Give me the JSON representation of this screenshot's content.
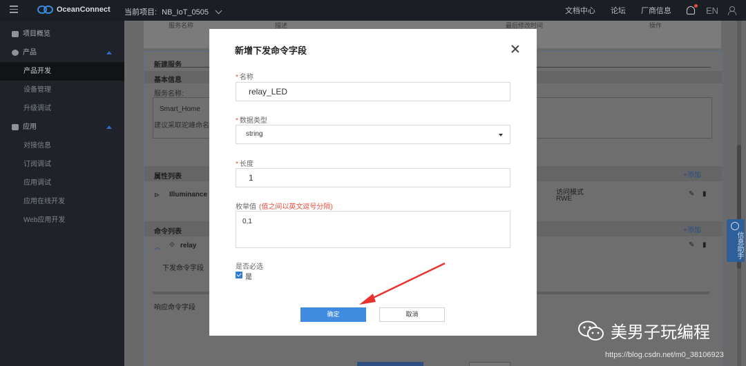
{
  "topbar": {
    "brand": "OceanConnect",
    "project_label": "当前项目:",
    "project_name": "NB_IoT_0505",
    "links": [
      "文档中心",
      "论坛",
      "厂商信息"
    ],
    "lang": "EN"
  },
  "sidebar": {
    "items": [
      {
        "label": "项目概览",
        "type": "top",
        "icon": "dashboard-icon"
      },
      {
        "label": "产品",
        "type": "group",
        "icon": "cube-icon"
      },
      {
        "label": "产品开发",
        "type": "sub",
        "active": true
      },
      {
        "label": "设备管理",
        "type": "sub"
      },
      {
        "label": "升级调试",
        "type": "sub"
      },
      {
        "label": "应用",
        "type": "group",
        "icon": "grid-icon"
      },
      {
        "label": "对接信息",
        "type": "sub"
      },
      {
        "label": "订阅调试",
        "type": "sub"
      },
      {
        "label": "应用调试",
        "type": "sub"
      },
      {
        "label": "应用在线开发",
        "type": "sub"
      },
      {
        "label": "Web应用开发",
        "type": "sub"
      }
    ]
  },
  "background": {
    "header_cols": [
      "服务名称",
      "描述",
      "最后修改时间",
      "操作"
    ],
    "new_service": "新建服务",
    "basic_info": "基本信息",
    "service_name_label": "服务名称:",
    "service_name_value": "Smart_Home",
    "naming_hint": "建议采取驼峰命名方",
    "property_list": "属性列表",
    "add": "+添加",
    "property_name": "Illuminance",
    "access_mode_label": "访问模式",
    "access_mode_value": "RWE",
    "command_list": "命令列表",
    "command_name": "relay",
    "downlink_fields": "下发命令字段",
    "response_fields": "响应命令字段",
    "helper": "信息助手"
  },
  "modal": {
    "title": "新增下发命令字段",
    "name_label": "名称",
    "name_value": "relay_LED",
    "datatype_label": "数据类型",
    "datatype_value": "string",
    "length_label": "长度",
    "length_value": "1",
    "enum_label": "枚举值",
    "enum_hint": "(值之间以英文逗号分隔)",
    "enum_value": "0,1",
    "required_label": "是否必选",
    "required_option": "是",
    "required_checked": true,
    "ok_label": "确定",
    "cancel_label": "取消"
  },
  "watermark": {
    "text": "美男子玩编程",
    "url": "https://blog.csdn.net/m0_38106923"
  },
  "colors": {
    "primary": "#3f8be0",
    "required": "#e84e40",
    "annotation_arrow": "#e8322c"
  }
}
